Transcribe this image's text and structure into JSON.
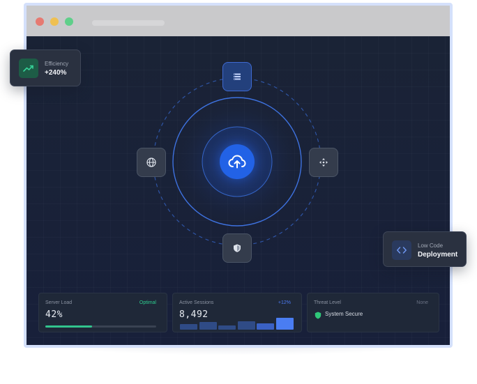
{
  "window": {
    "controls": [
      "close-dot",
      "minimize-dot",
      "maximize-dot"
    ]
  },
  "orbit_nodes": {
    "top": "server-list-icon",
    "left": "globe-icon",
    "right": "move-arrows-icon",
    "bottom": "shield-icon",
    "center": "cloud-upload-icon"
  },
  "stats": {
    "server_load": {
      "label": "Server Load",
      "tag": "Optimal",
      "value": "42%",
      "progress_fraction": 0.42,
      "tag_color": "#2ecc8f",
      "bar_color": "#32c48d"
    },
    "active_sessions": {
      "label": "Active Sessions",
      "tag": "+12%",
      "value": "8,492",
      "tag_color": "#4e7cf5",
      "bars": [
        0.35,
        0.5,
        0.25,
        0.55,
        0.42,
        0.75
      ],
      "bar_colors": [
        "#2f4b86",
        "#2f4b86",
        "#2f4b86",
        "#2f4b86",
        "#3a61c4",
        "#4a7df2"
      ]
    },
    "threat_level": {
      "label": "Threat Level",
      "tag": "None",
      "status": "System Secure",
      "tag_color": "#6b7385",
      "status_icon": "shield-check-icon",
      "status_color": "#2fc779"
    }
  },
  "floating": {
    "efficiency": {
      "label": "Efficiency",
      "value": "+240%",
      "icon": "trending-up-icon",
      "icon_bg": "#1d5c46",
      "icon_color": "#37d399"
    },
    "deployment": {
      "label": "Low Code",
      "value": "Deployment",
      "icon": "code-brackets-icon",
      "icon_bg": "#2a3a5e",
      "icon_color": "#6e96f0"
    }
  },
  "colors": {
    "window_bg": "#1a2234",
    "accent": "#2262e6",
    "frame": "#d4e0fb"
  }
}
